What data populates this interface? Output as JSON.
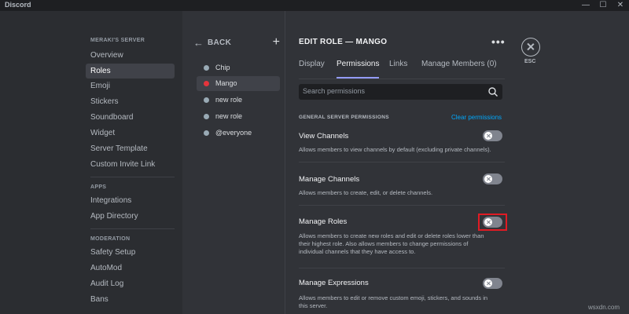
{
  "window": {
    "title": "Discord"
  },
  "sidebar": {
    "server_header": "MERAKI'S SERVER",
    "server_items": [
      "Overview",
      "Roles",
      "Emoji",
      "Stickers",
      "Soundboard",
      "Widget",
      "Server Template",
      "Custom Invite Link"
    ],
    "apps_header": "APPS",
    "apps_items": [
      "Integrations",
      "App Directory"
    ],
    "moderation_header": "MODERATION",
    "moderation_items": [
      "Safety Setup",
      "AutoMod",
      "Audit Log",
      "Bans"
    ]
  },
  "roles": {
    "back_label": "BACK",
    "items": [
      {
        "name": "Chip",
        "color": "#99aab5"
      },
      {
        "name": "Mango",
        "color": "#e5343c"
      },
      {
        "name": "new role",
        "color": "#99aab5"
      },
      {
        "name": "new role",
        "color": "#99aab5"
      },
      {
        "name": "@everyone",
        "color": "#99aab5"
      }
    ]
  },
  "main": {
    "title": "EDIT ROLE — MANGO",
    "tabs": [
      "Display",
      "Permissions",
      "Links",
      "Manage Members (0)"
    ],
    "active_tab": "Permissions",
    "search_placeholder": "Search permissions",
    "section_header": "GENERAL SERVER PERMISSIONS",
    "clear_label": "Clear permissions",
    "permissions": [
      {
        "title": "View Channels",
        "desc": [
          "Allows members to view channels by default (excluding private channels)."
        ],
        "enabled": false
      },
      {
        "title": "Manage Channels",
        "desc": [
          "Allows members to create, edit, or delete channels."
        ],
        "enabled": false
      },
      {
        "title": "Manage Roles",
        "desc": [
          "Allows members to create new roles and edit or delete roles lower than",
          "their highest role. Also allows members to change permissions of",
          "individual channels that they have access to."
        ],
        "enabled": false
      },
      {
        "title": "Manage Expressions",
        "desc": [
          "Allows members to edit or remove custom emoji, stickers, and sounds in",
          "this server."
        ],
        "enabled": false
      }
    ]
  },
  "esc_label": "ESC",
  "watermark": "wsxdn.com",
  "colors": {
    "accent": "#949cf7",
    "link": "#00a8fc",
    "highlight": "#e01b24"
  }
}
